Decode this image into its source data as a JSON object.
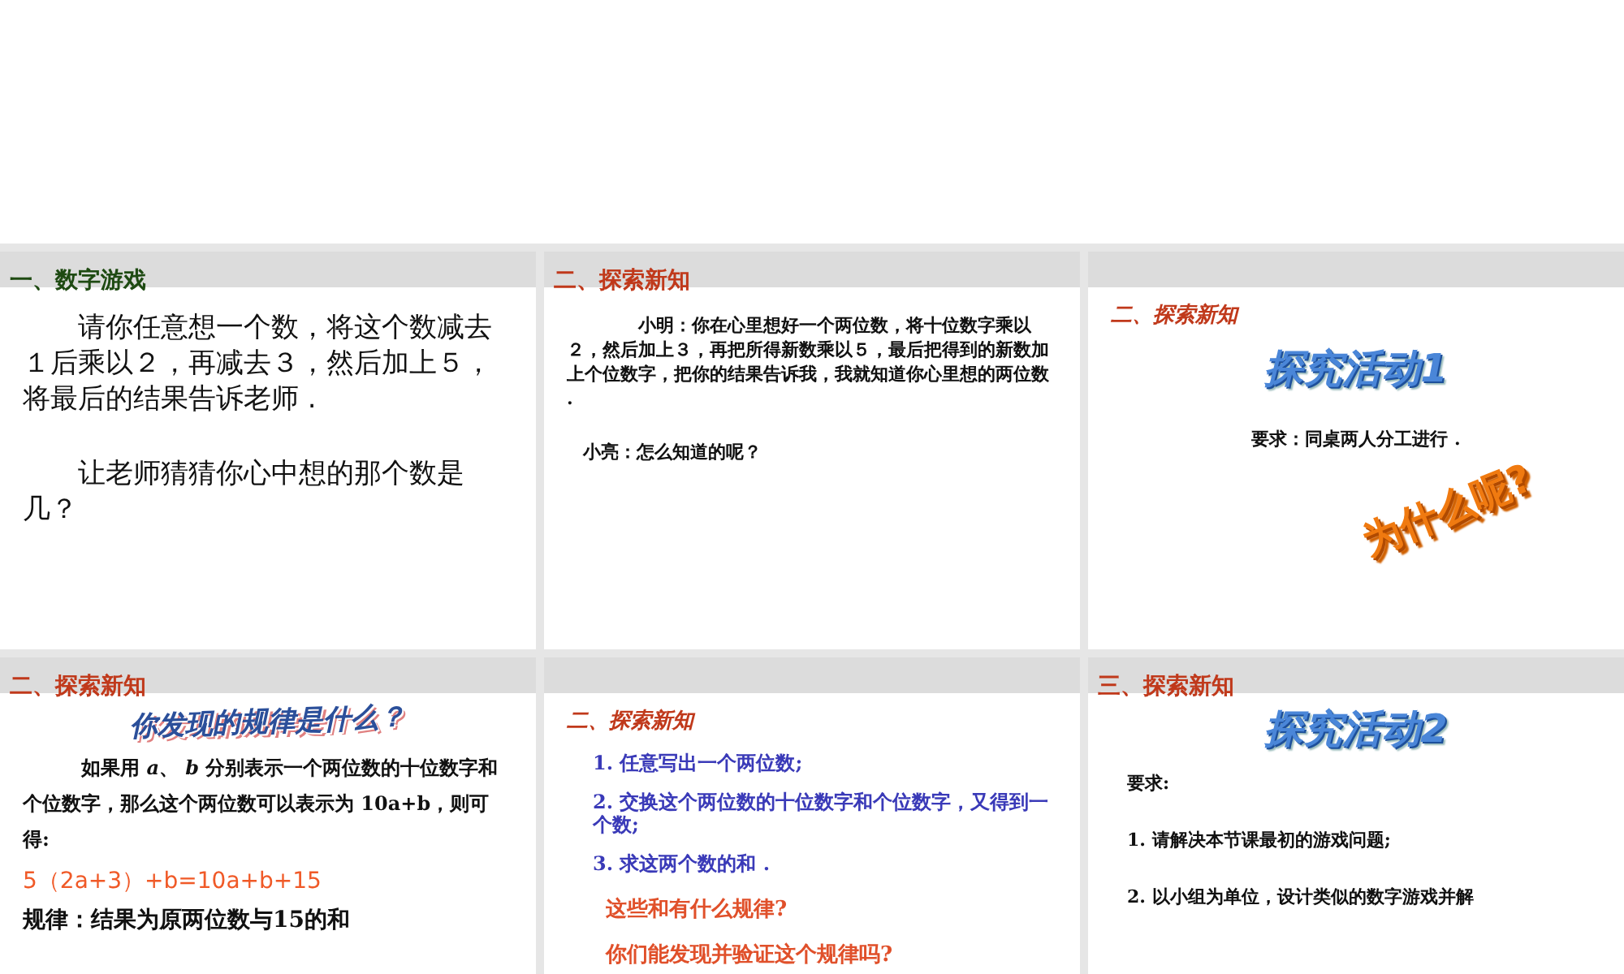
{
  "slides": [
    {
      "header": {
        "title": "一、数字游戏",
        "color": "#1e4a12"
      },
      "blocks": [
        {
          "kind": "big",
          "text": "请你任意想一个数，将这个数减去１后乘以２，再减去３，然后加上５，将最后的结果告诉老师 ."
        },
        {
          "kind": "big",
          "text": "让老师猜猜你心中想的那个数是几？"
        }
      ]
    },
    {
      "header": {
        "title": "二、探索新知",
        "color": "#c0391b"
      },
      "blocks": [
        {
          "kind": "small",
          "text": "小明：你在心里想好一个两位数，将十位数字乘以２，然后加上３，再把所得新数乘以５，最后把得到的新数加上个位数字，把你的结果告诉我，我就知道你心里想的两位数 ."
        },
        {
          "kind": "plain",
          "text": "小亮：怎么知道的呢？"
        }
      ]
    },
    {
      "blocks": [
        {
          "kind": "section",
          "text": "二、探索新知"
        },
        {
          "kind": "wordart",
          "text": "探究活动1"
        },
        {
          "kind": "center",
          "text": "要求：同桌两人分工进行 ."
        },
        {
          "kind": "tilted",
          "text": "为什么呢?"
        }
      ]
    },
    {
      "header": {
        "title": "二、探索新知",
        "color": "#c0391b"
      },
      "blocks": [
        {
          "kind": "banner",
          "text": "你发现的规律是什么？"
        },
        {
          "kind": "medium",
          "text": "如果用 *a*、 *b* 分别表示一个两位数的十位数字和个位数字，那么这个两位数可以表示为 10a+b，则可得:"
        },
        {
          "kind": "formula",
          "text": "5（2a+3）+b=10a+b+15"
        },
        {
          "kind": "conclusion",
          "text": "规律：结果为原两位数与15的和"
        }
      ]
    },
    {
      "blocks": [
        {
          "kind": "section",
          "text": "二、探索新知"
        },
        {
          "kind": "step",
          "text": "1. 任意写出一个两位数;"
        },
        {
          "kind": "step",
          "text": "2. 交换这个两位数的十位数字和个位数字，又得到一个数;"
        },
        {
          "kind": "step",
          "text": "3. 求这两个数的和 ."
        },
        {
          "kind": "question",
          "text": "这些和有什么规律?"
        },
        {
          "kind": "question",
          "text": "你们能发现并验证这个规律吗?"
        }
      ]
    },
    {
      "header": {
        "title": "三、探索新知",
        "color": "#c0391b"
      },
      "blocks": [
        {
          "kind": "wordart",
          "text": "探究活动2"
        },
        {
          "kind": "plain",
          "text": "要求:"
        },
        {
          "kind": "plain",
          "text": "1. 请解决本节课最初的游戏问题;"
        },
        {
          "kind": "plain",
          "text": "2. 以小组为单位，设计类似的数字游戏并解"
        }
      ]
    }
  ]
}
